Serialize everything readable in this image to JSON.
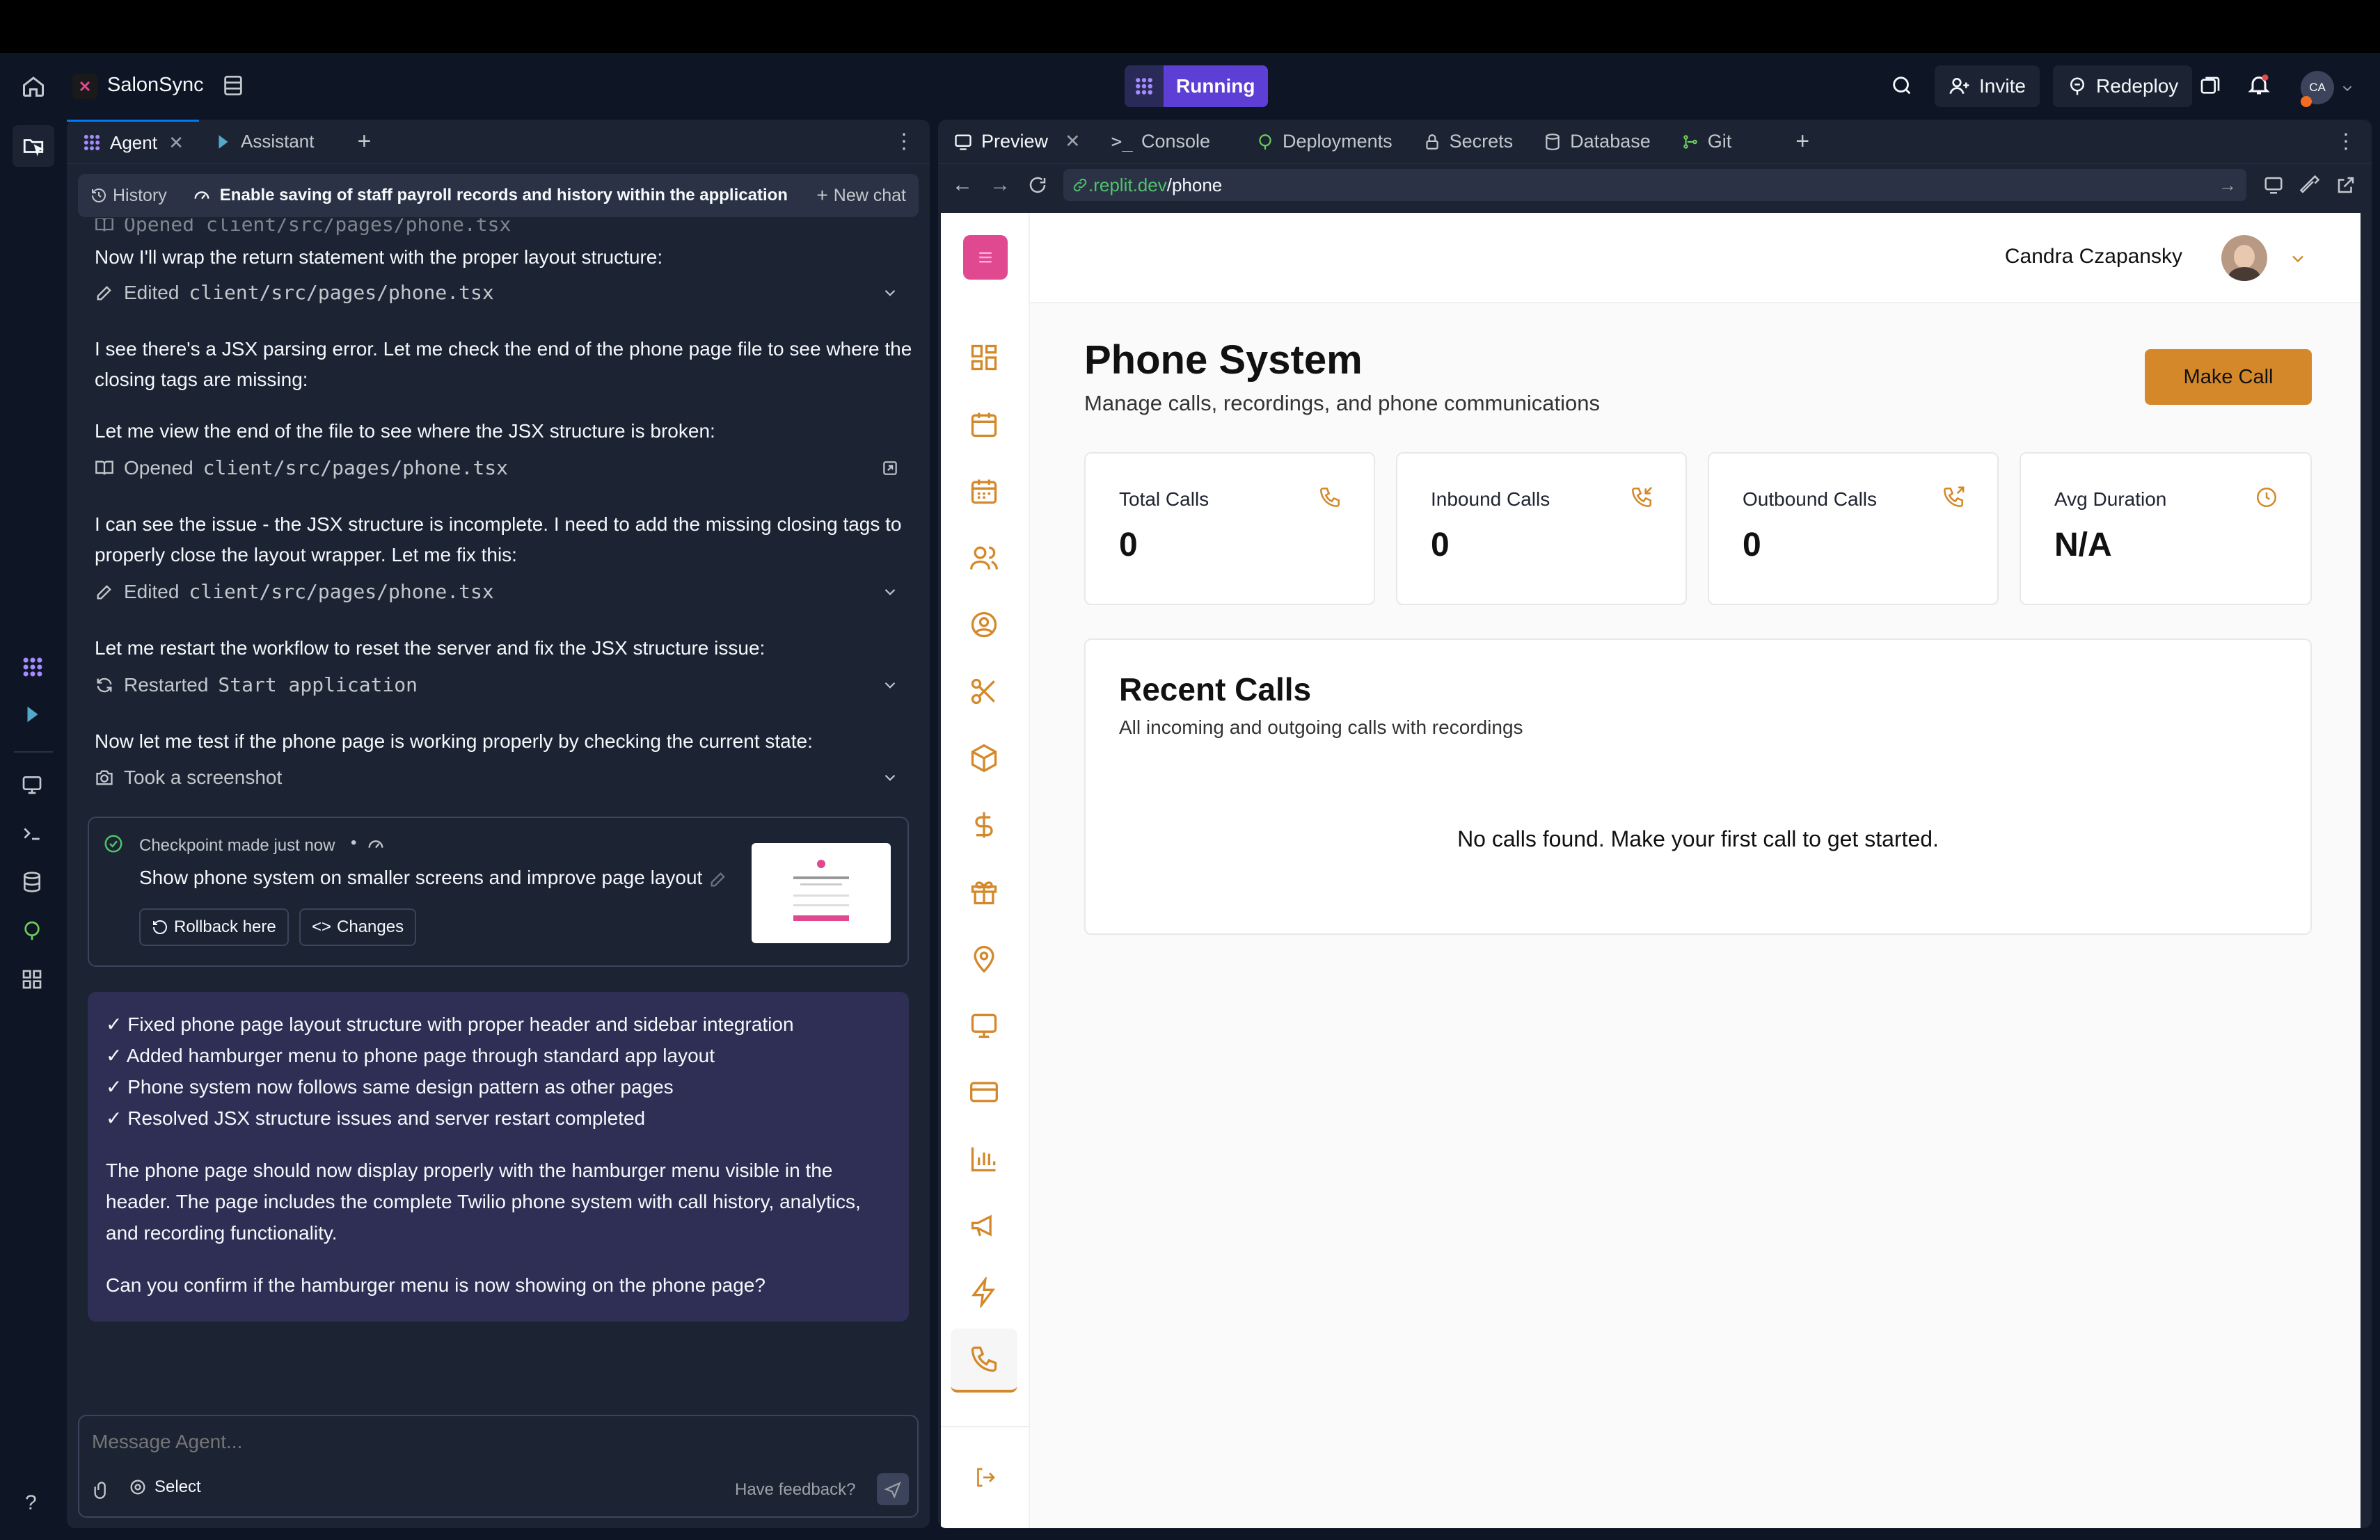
{
  "app": {
    "name": "SalonSync",
    "run_label": "Running",
    "invite": "Invite",
    "redeploy": "Redeploy",
    "avatar_initials": "CA"
  },
  "left_tabs": {
    "agent": "Agent",
    "assistant": "Assistant"
  },
  "agent_header": {
    "history": "History",
    "title": "Enable saving of staff payroll records and history within the application",
    "new_chat": "New chat"
  },
  "chat": {
    "opened_top": "Opened client/src/pages/phone.tsx",
    "m1": "Now I'll wrap the return statement with the proper layout structure:",
    "a1_prefix": "Edited",
    "a1_path": "client/src/pages/phone.tsx",
    "m2": "I see there's a JSX parsing error. Let me check the end of the phone page file to see where the closing tags are missing:",
    "m3": "Let me view the end of the file to see where the JSX structure is broken:",
    "a2_prefix": "Opened",
    "a2_path": "client/src/pages/phone.tsx",
    "m4": "I can see the issue - the JSX structure is incomplete. I need to add the missing closing tags to properly close the layout wrapper. Let me fix this:",
    "a3_prefix": "Edited",
    "a3_path": "client/src/pages/phone.tsx",
    "m5": "Let me restart the workflow to reset the server and fix the JSX structure issue:",
    "a4_prefix": "Restarted",
    "a4_path": "Start application",
    "m6": "Now let me test if the phone page is working properly by checking the current state:",
    "a5": "Took a screenshot",
    "checkpoint": {
      "meta": "Checkpoint made just now",
      "title": "Show phone system on smaller screens and improve page layout",
      "rollback": "Rollback here",
      "changes": "Changes"
    },
    "summary": {
      "bullets": [
        "✓ Fixed phone page layout structure with proper header and sidebar integration",
        "✓ Added hamburger menu to phone page through standard app layout",
        "✓ Phone system now follows same design pattern as other pages",
        "✓ Resolved JSX structure issues and server restart completed"
      ],
      "p1": "The phone page should now display properly with the hamburger menu visible in the header. The page includes the complete Twilio phone system with call history, analytics, and recording functionality.",
      "p2": "Can you confirm if the hamburger menu is now showing on the phone page?"
    }
  },
  "composer": {
    "placeholder": "Message Agent...",
    "select": "Select",
    "feedback": "Have feedback?"
  },
  "right_tabs": {
    "preview": "Preview",
    "console": "Console",
    "deployments": "Deployments",
    "secrets": "Secrets",
    "database": "Database",
    "git": "Git"
  },
  "url": {
    "domain": ".replit.dev",
    "path": "/phone"
  },
  "site": {
    "user_name": "Candra Czapansky",
    "title": "Phone System",
    "subtitle": "Manage calls, recordings, and phone communications",
    "make_call": "Make Call",
    "stats": [
      {
        "label": "Total Calls",
        "value": "0"
      },
      {
        "label": "Inbound Calls",
        "value": "0"
      },
      {
        "label": "Outbound Calls",
        "value": "0"
      },
      {
        "label": "Avg Duration",
        "value": "N/A"
      }
    ],
    "recent_title": "Recent Calls",
    "recent_subtitle": "All incoming and outgoing calls with recordings",
    "empty": "No calls found. Make your first call to get started."
  },
  "colors": {
    "accent": "#d4882a",
    "running": "#5e3fd6",
    "brand_pink": "#e0488f",
    "summary_bg": "#2f2e54"
  }
}
